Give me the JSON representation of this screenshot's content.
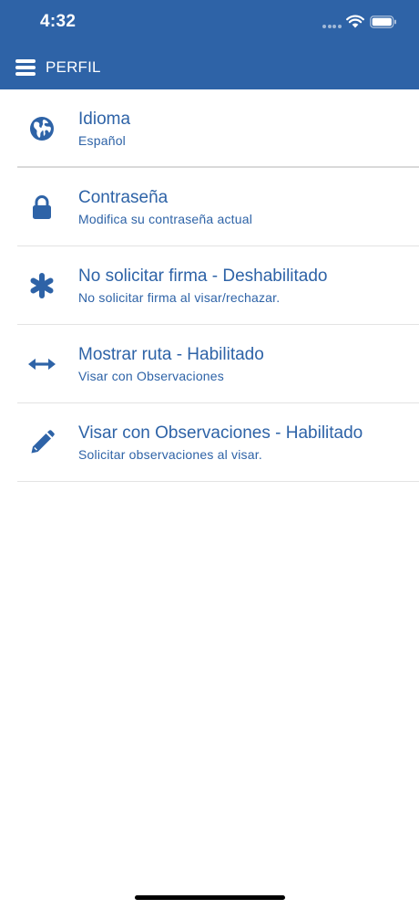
{
  "status_bar": {
    "time": "4:32"
  },
  "header": {
    "title": "PERFIL",
    "menu_icon": "hamburger-menu-icon"
  },
  "colors": {
    "primary": "#2e63a7",
    "background": "#ffffff",
    "divider": "#e3e3e3"
  },
  "items": [
    {
      "title": "Idioma",
      "subtitle": "Español",
      "icon": "globe-icon"
    },
    {
      "title": "Contraseña",
      "subtitle": "Modifica su contraseña actual",
      "icon": "lock-icon"
    },
    {
      "title": "No solicitar firma - Deshabilitado",
      "subtitle": "No solicitar firma al visar/rechazar.",
      "icon": "asterisk-icon"
    },
    {
      "title": "Mostrar ruta - Habilitado",
      "subtitle": "Visar con Observaciones",
      "icon": "arrows-horizontal-icon"
    },
    {
      "title": "Visar con Observaciones - Habilitado",
      "subtitle": "Solicitar observaciones al visar.",
      "icon": "pencil-icon"
    }
  ]
}
